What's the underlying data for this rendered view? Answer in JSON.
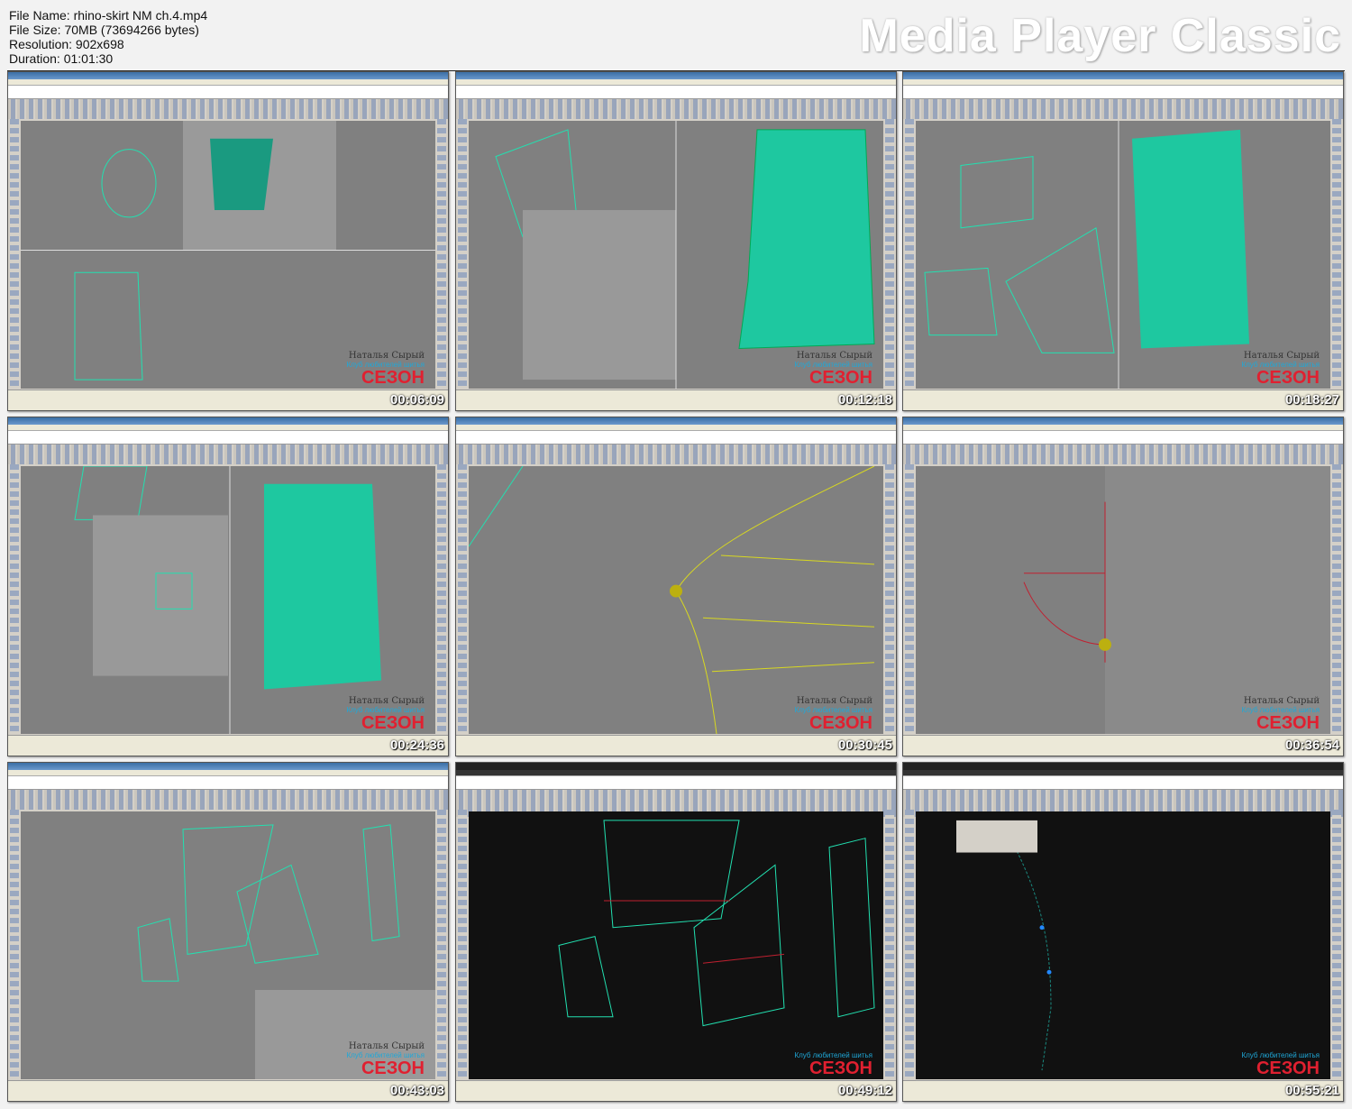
{
  "file_info": {
    "file_name": "File Name: rhino-skirt NM ch.4.mp4",
    "file_size": "File Size: 70MB (73694266 bytes)",
    "resolution": "Resolution: 902x698",
    "duration": "Duration: 01:01:30"
  },
  "brand": "Media Player Classic",
  "watermark": {
    "author": "Наталья Сырый",
    "club": "Клуб любителей шитья",
    "logo": "СЕЗОН"
  },
  "colors": {
    "wire": "#22e0b0",
    "accent_red": "#e02030",
    "club_blue": "#1fa8d8"
  },
  "thumbnails": [
    {
      "time": "00:06:09",
      "app": "rhino"
    },
    {
      "time": "00:12:18",
      "app": "rhino"
    },
    {
      "time": "00:18:27",
      "app": "rhino"
    },
    {
      "time": "00:24:36",
      "app": "rhino"
    },
    {
      "time": "00:30:45",
      "app": "rhino"
    },
    {
      "time": "00:36:54",
      "app": "rhino"
    },
    {
      "time": "00:43:03",
      "app": "rhino"
    },
    {
      "time": "00:49:12",
      "app": "autocad"
    },
    {
      "time": "00:55:21",
      "app": "autocad"
    }
  ]
}
